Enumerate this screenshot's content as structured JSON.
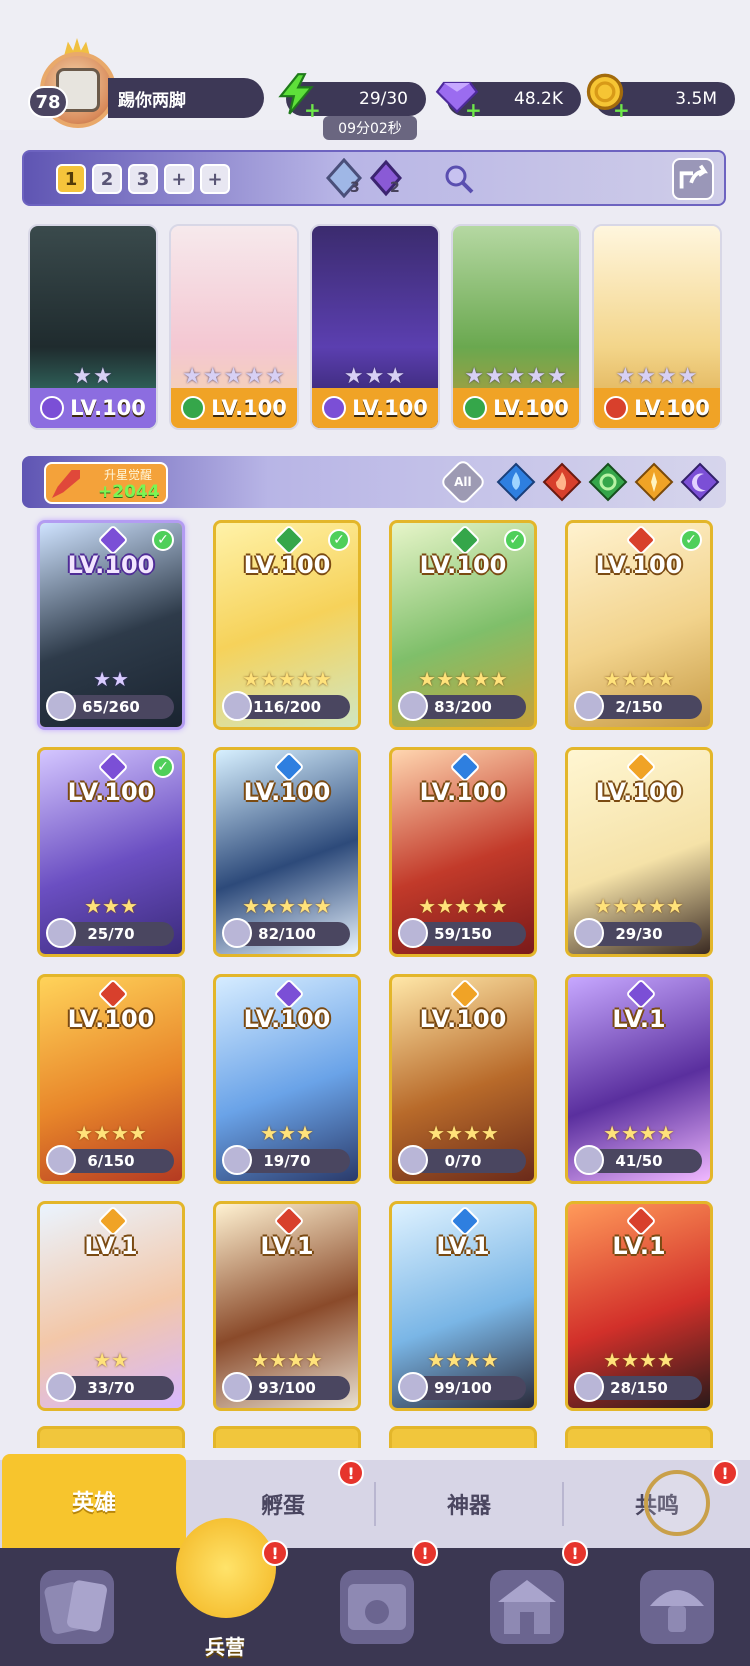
{
  "player": {
    "level": "78",
    "name": "踢你两脚"
  },
  "resources": {
    "energy": "29/30",
    "energy_timer": "09分02秒",
    "gems": "48.2K",
    "coins": "3.5M"
  },
  "team_slots": [
    "1",
    "2",
    "3",
    "+",
    "+"
  ],
  "team_chips": {
    "blue_count": "3",
    "purple_count": "2"
  },
  "team": [
    {
      "level": "LV.100",
      "stars": "★★",
      "element": "purple"
    },
    {
      "level": "LV.100",
      "stars": "★★★★★",
      "element": "green"
    },
    {
      "level": "LV.100",
      "stars": "★★★",
      "element": "purple"
    },
    {
      "level": "LV.100",
      "stars": "★★★★★",
      "element": "green"
    },
    {
      "level": "LV.100",
      "stars": "★★★★",
      "element": "red"
    }
  ],
  "awaken": {
    "label": "升星觉醒",
    "value": "+2044"
  },
  "filters": [
    "All"
  ],
  "heroes": [
    {
      "level": "LV.100",
      "progress": "65/260",
      "stars": "★★",
      "element": "purple",
      "rarity": "purple",
      "checked": true
    },
    {
      "level": "LV.100",
      "progress": "116/200",
      "stars": "★★★★★",
      "element": "green",
      "rarity": "gold",
      "checked": true
    },
    {
      "level": "LV.100",
      "progress": "83/200",
      "stars": "★★★★★",
      "element": "green",
      "rarity": "gold",
      "checked": true
    },
    {
      "level": "LV.100",
      "progress": "2/150",
      "stars": "★★★★",
      "element": "red",
      "rarity": "gold",
      "checked": true
    },
    {
      "level": "LV.100",
      "progress": "25/70",
      "stars": "★★★",
      "element": "purple",
      "rarity": "gold",
      "checked": true
    },
    {
      "level": "LV.100",
      "progress": "82/100",
      "stars": "★★★★★",
      "element": "blue",
      "rarity": "gold",
      "checked": false
    },
    {
      "level": "LV.100",
      "progress": "59/150",
      "stars": "★★★★★",
      "element": "blue",
      "rarity": "gold",
      "checked": false
    },
    {
      "level": "LV.100",
      "progress": "29/30",
      "stars": "★★★★★",
      "element": "yellow",
      "rarity": "gold",
      "checked": false
    },
    {
      "level": "LV.100",
      "progress": "6/150",
      "stars": "★★★★",
      "element": "red",
      "rarity": "gold",
      "checked": false
    },
    {
      "level": "LV.100",
      "progress": "19/70",
      "stars": "★★★",
      "element": "purple",
      "rarity": "gold",
      "checked": false
    },
    {
      "level": "LV.100",
      "progress": "0/70",
      "stars": "★★★★",
      "element": "yellow",
      "rarity": "gold",
      "checked": false
    },
    {
      "level": "LV.1",
      "progress": "41/50",
      "stars": "★★★★",
      "element": "purple",
      "rarity": "gold",
      "checked": false
    },
    {
      "level": "LV.1",
      "progress": "33/70",
      "stars": "★★",
      "element": "yellow",
      "rarity": "gold",
      "checked": false
    },
    {
      "level": "LV.1",
      "progress": "93/100",
      "stars": "★★★★",
      "element": "red",
      "rarity": "gold",
      "checked": false
    },
    {
      "level": "LV.1",
      "progress": "99/100",
      "stars": "★★★★",
      "element": "blue",
      "rarity": "gold",
      "checked": false
    },
    {
      "level": "LV.1",
      "progress": "28/150",
      "stars": "★★★★",
      "element": "red",
      "rarity": "gold",
      "checked": false
    }
  ],
  "subtabs": [
    {
      "label": "英雄",
      "badge": ""
    },
    {
      "label": "孵蛋",
      "badge": "!"
    },
    {
      "label": "神器",
      "badge": ""
    },
    {
      "label": "共鸣",
      "badge": "!"
    }
  ],
  "nav": [
    {
      "label": "",
      "badge": ""
    },
    {
      "label": "兵营",
      "badge": "!"
    },
    {
      "label": "",
      "badge": "!"
    },
    {
      "label": "",
      "badge": "!"
    },
    {
      "label": "",
      "badge": ""
    }
  ],
  "colors": {
    "purple": "#7b4fd6",
    "green": "#35a64a",
    "red": "#d8402c",
    "blue": "#2e7fe0",
    "yellow": "#f0a326"
  }
}
